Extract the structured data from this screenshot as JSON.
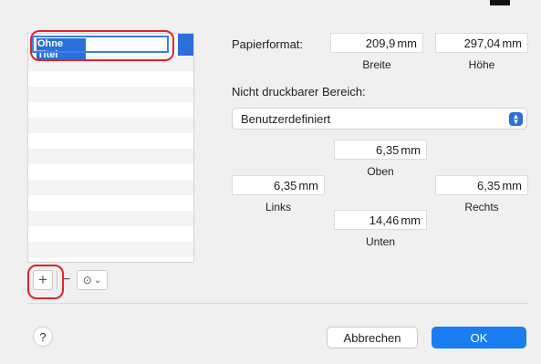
{
  "list": {
    "selected_name": "Ohne Titel"
  },
  "list_buttons": {
    "add": "+",
    "remove": "−",
    "action_icon": "⊙",
    "action_chevron": "⌄"
  },
  "paper": {
    "label": "Papierformat:",
    "width_value": "209,9",
    "height_value": "297,04",
    "unit": "mm",
    "width_caption": "Breite",
    "height_caption": "Höhe"
  },
  "margins": {
    "section_label": "Nicht druckbarer Bereich:",
    "preset_selected": "Benutzerdefiniert",
    "top_value": "6,35",
    "top_caption": "Oben",
    "left_value": "6,35",
    "left_caption": "Links",
    "right_value": "6,35",
    "right_caption": "Rechts",
    "bottom_value": "14,46",
    "bottom_caption": "Unten"
  },
  "footer": {
    "help_label": "?",
    "cancel_label": "Abbrechen",
    "ok_label": "OK"
  },
  "colors": {
    "accent": "#1a7df2",
    "selection": "#2b6fd8",
    "highlight": "#e3232d"
  }
}
